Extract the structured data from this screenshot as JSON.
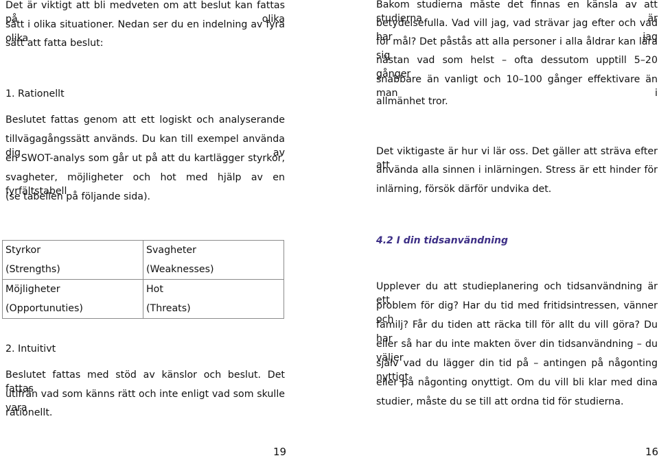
{
  "left_page": {
    "intro_lines": [
      "Det är viktigt att bli medveten om att beslut kan fattas på olika",
      "sätt i olika situationer. Nedan ser du en indelning av fyra olika",
      "sätt att fatta beslut:"
    ],
    "section1_title": "1. Rationellt",
    "section1_lines": [
      "Beslutet fattas genom att ett logiskt och analyserande",
      "tillvägagångssätt används. Du kan till exempel använda dig av",
      "en SWOT-analys som går ut på att du kartlägger styrkor,",
      "svagheter, möjligheter och hot med hjälp av en fyrfältstabell",
      "(se tabellen på följande sida)."
    ],
    "swot_table": {
      "rows": [
        [
          {
            "line1": "Styrkor",
            "line2": "(Strengths)"
          },
          {
            "line1": "Svagheter",
            "line2": "(Weaknesses)"
          }
        ],
        [
          {
            "line1": "Möjligheter",
            "line2": "(Opportunuties)"
          },
          {
            "line1": "Hot",
            "line2": "(Threats)"
          }
        ]
      ]
    },
    "section2_title": "2. Intuitivt",
    "section2_lines": [
      "Beslutet fattas med stöd av känslor och beslut. Det fattas",
      "utifrån vad som känns rätt och inte enligt vad som skulle vara",
      "rationellt."
    ],
    "page_number": "19"
  },
  "right_page": {
    "para1_lines": [
      "Bakom studierna måste det finnas en känsla av att studierna är",
      "betydelsefulla. Vad vill jag, vad strävar jag efter och vad har jag",
      "för mål? Det påstås att alla personer i alla åldrar kan lära sig",
      "nästan vad som helst – ofta dessutom upptill 5–20 gånger",
      "snabbare än vanligt och 10–100 gånger effektivare än man i",
      "allmänhet tror."
    ],
    "para2_lines": [
      "Det viktigaste är hur vi lär oss. Det gäller att sträva efter att",
      "använda alla sinnen i inlärningen. Stress är ett hinder för",
      "inlärning, försök därför undvika det."
    ],
    "heading": "4.2 I din tidsanvändning",
    "heading_color": "#3d2f86",
    "para3_lines": [
      "Upplever du att studieplanering och tidsanvändning är ett",
      "problem för dig? Har du tid med fritidsintressen, vänner och",
      "familj? Får du tiden att räcka till för allt du vill göra? Du har",
      "eller så har du inte makten över din tidsanvändning – du väljer",
      "själv vad du lägger din tid på – antingen på någonting nyttigt",
      "eller på någonting onyttigt. Om du vill bli klar med dina",
      "studier, måste du se till att ordna tid för studierna."
    ],
    "page_number": "16"
  }
}
